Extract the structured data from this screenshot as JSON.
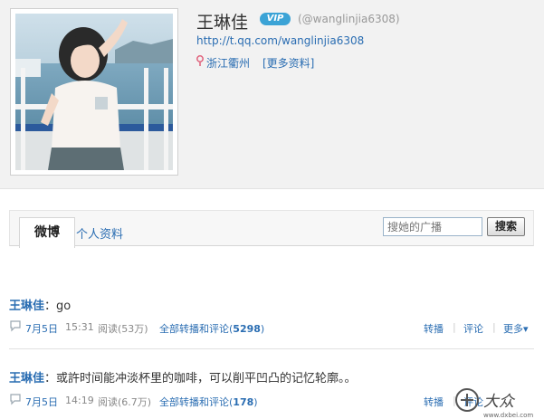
{
  "profile": {
    "name": "王琳佳",
    "vip_badge": "VIP",
    "handle": "(@wanglinjia6308)",
    "url": "http://t.qq.com/wanglinjia6308",
    "location": "浙江衢州",
    "more_info": "[更多资料]"
  },
  "tabs": {
    "active": "微博",
    "other": "个人资料"
  },
  "search": {
    "placeholder": "搜她的广播",
    "button": "搜索"
  },
  "posts": [
    {
      "author": "王琳佳",
      "colon": "：",
      "text": "go",
      "date": "7月5日",
      "time": "15:31",
      "reads": "阅读(53万)",
      "all_label": "全部转播和评论(",
      "count": "5298",
      "close": ")",
      "repost": "转播",
      "comment": "评论",
      "more": "更多▾"
    },
    {
      "author": "王琳佳",
      "colon": "：",
      "text": "或許时间能冲淡杯里的咖啡，可以削平凹凸的记忆轮廓。。",
      "date": "7月5日",
      "time": "14:19",
      "reads": "阅读(6.7万)",
      "all_label": "全部转播和评论(",
      "count": "178",
      "close": ")",
      "repost": "转播",
      "comment": "评论"
    }
  ],
  "watermark": {
    "text": "大众",
    "site": "www.dxbei.com"
  },
  "colors": {
    "link": "#2a6db2",
    "header_bg": "#f2f2f2",
    "vip": "#3ba3d6"
  }
}
